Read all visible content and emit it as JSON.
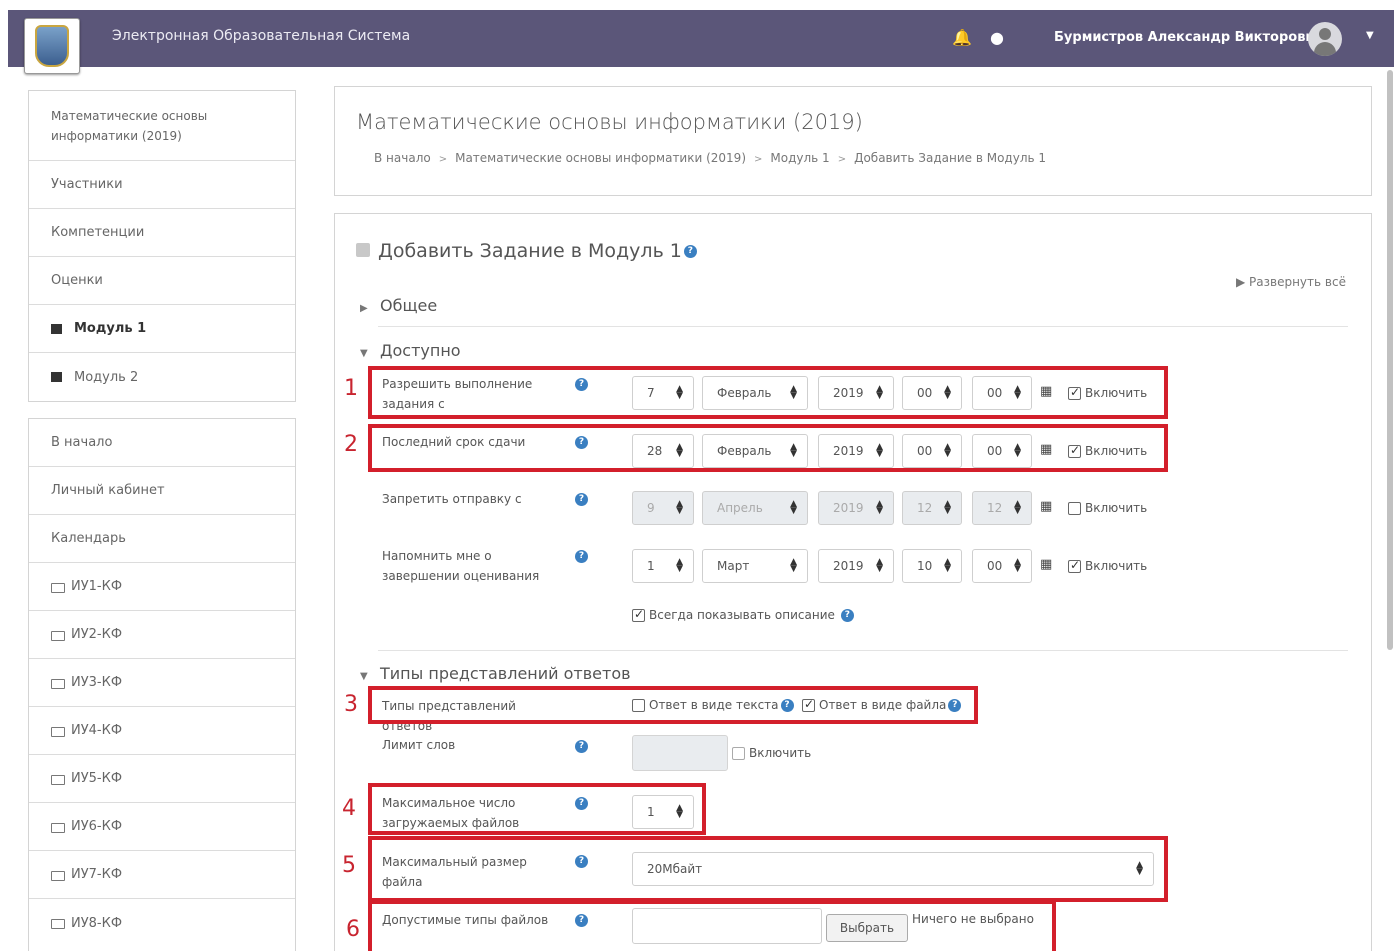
{
  "navbar": {
    "site_title": "Электронная Образовательная Система",
    "user_name": "Бурмистров Александр Викторович"
  },
  "sidebar": {
    "course_items": [
      {
        "label": "Математические основы информатики (2019)"
      },
      {
        "label": "Участники"
      },
      {
        "label": "Компетенции"
      },
      {
        "label": "Оценки"
      },
      {
        "label": "Модуль 1"
      },
      {
        "label": "Модуль 2"
      }
    ],
    "nav_items": [
      {
        "label": "В начало"
      },
      {
        "label": "Личный кабинет"
      },
      {
        "label": "Календарь"
      },
      {
        "label": "ИУ1-КФ"
      },
      {
        "label": "ИУ2-КФ"
      },
      {
        "label": "ИУ3-КФ"
      },
      {
        "label": "ИУ4-КФ"
      },
      {
        "label": "ИУ5-КФ"
      },
      {
        "label": "ИУ6-КФ"
      },
      {
        "label": "ИУ7-КФ"
      },
      {
        "label": "ИУ8-КФ"
      }
    ]
  },
  "header": {
    "title": "Математические основы информатики (2019)",
    "breadcrumb": [
      "В начало",
      "Математические основы информатики (2019)",
      "Модуль 1",
      "Добавить Задание в Модуль 1"
    ]
  },
  "form": {
    "title": "Добавить Задание в Модуль 1",
    "expand_all": "Развернуть всё",
    "sections": {
      "general": "Общее",
      "availability": "Доступно",
      "submission_types": "Типы представлений ответов"
    },
    "enable_label": "Включить",
    "dates": [
      {
        "label": "Разрешить выполнение задания с",
        "day": "7",
        "month": "Февраль",
        "year": "2019",
        "hour": "00",
        "minute": "00",
        "enabled": true
      },
      {
        "label": "Последний срок сдачи",
        "day": "28",
        "month": "Февраль",
        "year": "2019",
        "hour": "00",
        "minute": "00",
        "enabled": true
      },
      {
        "label": "Запретить отправку с",
        "day": "9",
        "month": "Апрель",
        "year": "2019",
        "hour": "12",
        "minute": "12",
        "enabled": false
      },
      {
        "label": "Напомнить мне о завершении оценивания",
        "day": "1",
        "month": "Март",
        "year": "2019",
        "hour": "10",
        "minute": "00",
        "enabled": true
      }
    ],
    "always_show_description": "Всегда показывать описание",
    "submission_types_label": "Типы представлений ответов",
    "online_text": "Ответ в виде текста",
    "file_submission": "Ответ в виде файла",
    "word_limit_label": "Лимит слов",
    "max_files_label": "Максимальное число загружаемых файлов",
    "max_files_value": "1",
    "max_size_label": "Максимальный размер файла",
    "max_size_value": "20Мбайт",
    "file_types_label": "Допустимые типы файлов",
    "choose_button": "Выбрать",
    "nothing_selected": "Ничего не выбрано"
  },
  "annotations": [
    "1",
    "2",
    "3",
    "4",
    "5",
    "6"
  ],
  "colors": {
    "navbar": "#5b5679",
    "annotation_red": "#d31f2b",
    "help_blue": "#3a7fc1"
  }
}
